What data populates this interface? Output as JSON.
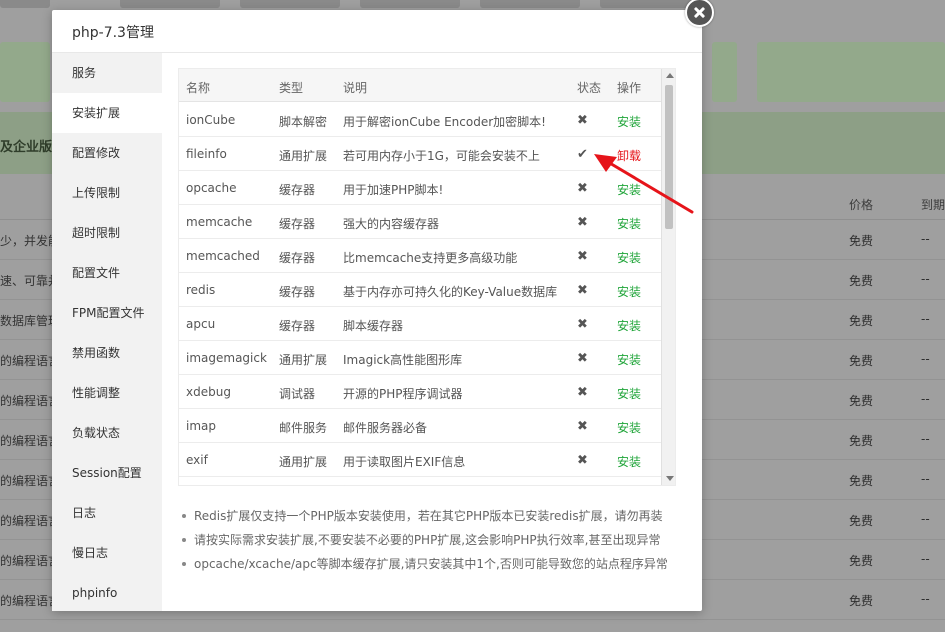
{
  "colors": {
    "install": "#20a53a",
    "uninstall": "#e6141a",
    "arrow": "#e6141a"
  },
  "modal": {
    "title": "php-7.3管理",
    "close_icon": "close-icon"
  },
  "sidebar": {
    "items": [
      {
        "label": "服务"
      },
      {
        "label": "安装扩展",
        "active": true
      },
      {
        "label": "配置修改"
      },
      {
        "label": "上传限制"
      },
      {
        "label": "超时限制"
      },
      {
        "label": "配置文件"
      },
      {
        "label": "FPM配置文件"
      },
      {
        "label": "禁用函数"
      },
      {
        "label": "性能调整"
      },
      {
        "label": "负载状态"
      },
      {
        "label": "Session配置"
      },
      {
        "label": "日志"
      },
      {
        "label": "慢日志"
      },
      {
        "label": "phpinfo"
      }
    ]
  },
  "table": {
    "headers": [
      "名称",
      "类型",
      "说明",
      "状态",
      "操作"
    ],
    "rows": [
      {
        "name": "ionCube",
        "type": "脚本解密",
        "desc": "用于解密ionCube Encoder加密脚本!",
        "status": "✖",
        "action": "安装"
      },
      {
        "name": "fileinfo",
        "type": "通用扩展",
        "desc": "若可用内存小于1G，可能会安装不上",
        "status": "✔",
        "action": "卸载"
      },
      {
        "name": "opcache",
        "type": "缓存器",
        "desc": "用于加速PHP脚本!",
        "status": "✖",
        "action": "安装"
      },
      {
        "name": "memcache",
        "type": "缓存器",
        "desc": "强大的内容缓存器",
        "status": "✖",
        "action": "安装"
      },
      {
        "name": "memcached",
        "type": "缓存器",
        "desc": "比memcache支持更多高级功能",
        "status": "✖",
        "action": "安装"
      },
      {
        "name": "redis",
        "type": "缓存器",
        "desc": "基于内存亦可持久化的Key-Value数据库",
        "status": "✖",
        "action": "安装"
      },
      {
        "name": "apcu",
        "type": "缓存器",
        "desc": "脚本缓存器",
        "status": "✖",
        "action": "安装"
      },
      {
        "name": "imagemagick",
        "type": "通用扩展",
        "desc": "Imagick高性能图形库",
        "status": "✖",
        "action": "安装"
      },
      {
        "name": "xdebug",
        "type": "调试器",
        "desc": "开源的PHP程序调试器",
        "status": "✖",
        "action": "安装"
      },
      {
        "name": "imap",
        "type": "邮件服务",
        "desc": "邮件服务器必备",
        "status": "✖",
        "action": "安装"
      },
      {
        "name": "exif",
        "type": "通用扩展",
        "desc": "用于读取图片EXIF信息",
        "status": "✖",
        "action": "安装"
      }
    ]
  },
  "notes": [
    "Redis扩展仅支持一个PHP版本安装使用，若在其它PHP版本已安装redis扩展，请勿再装",
    "请按实际需求安装扩展,不要安装不必要的PHP扩展,这会影响PHP执行效率,甚至出现异常",
    "opcache/xcache/apc等脚本缓存扩展,请只安装其中1个,否则可能导致您的站点程序异常"
  ],
  "background": {
    "banner_text": "及企业版",
    "headers": {
      "price": "价格",
      "expire": "到期"
    },
    "rows": [
      {
        "left": "少，并发能",
        "price": "免费",
        "expire": "--"
      },
      {
        "left": "速、可靠并",
        "price": "免费",
        "expire": "--"
      },
      {
        "left": "数据库管理",
        "price": "免费",
        "expire": "--"
      },
      {
        "left": "的编程语言",
        "price": "免费",
        "expire": "--"
      },
      {
        "left": "的编程语言",
        "price": "免费",
        "expire": "--"
      },
      {
        "left": "的编程语言",
        "price": "免费",
        "expire": "--"
      },
      {
        "left": "的编程语言",
        "price": "免费",
        "expire": "--"
      },
      {
        "left": "的编程语言",
        "price": "免费",
        "expire": "--"
      },
      {
        "left": "的编程语言",
        "price": "免费",
        "expire": "--"
      },
      {
        "left": "的编程语言",
        "price": "免费",
        "expire": "--"
      }
    ]
  }
}
